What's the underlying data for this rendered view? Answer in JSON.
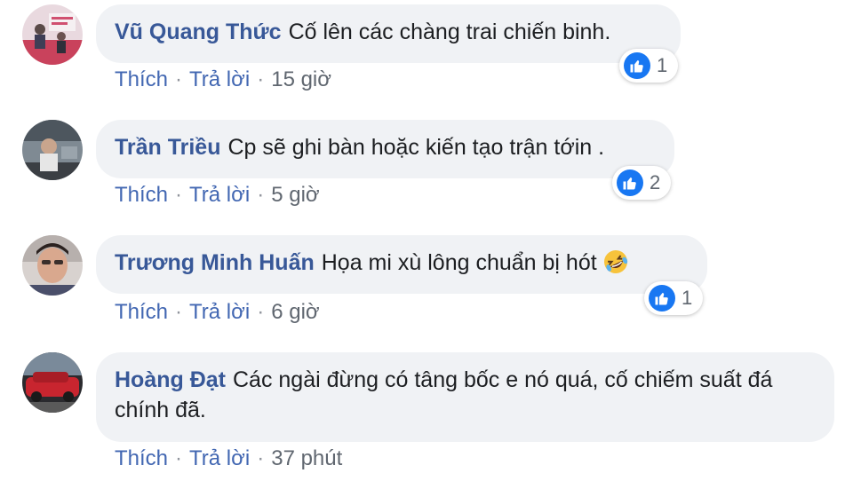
{
  "comments": [
    {
      "author": "Vũ Quang Thức",
      "text": "Cố lên các chàng trai chiến binh.",
      "actions": {
        "like": "Thích",
        "reply": "Trả lời",
        "separator": "·",
        "time": "15 giờ"
      },
      "reactions": {
        "icon": "like-icon",
        "count": "1"
      }
    },
    {
      "author": "Trần Triều",
      "text": "Cp sẽ ghi bàn hoặc kiến tạo trận tớin .",
      "actions": {
        "like": "Thích",
        "reply": "Trả lời",
        "separator": "·",
        "time": "5 giờ"
      },
      "reactions": {
        "icon": "like-icon",
        "count": "2"
      }
    },
    {
      "author": "Trương Minh Huấn",
      "text": "Họa mi xù lông chuẩn bị hót",
      "emoji": "rolling-on-floor-laughing-emoji",
      "actions": {
        "like": "Thích",
        "reply": "Trả lời",
        "separator": "·",
        "time": "6 giờ"
      },
      "reactions": {
        "icon": "like-icon",
        "count": "1"
      }
    },
    {
      "author": "Hoàng Đạt",
      "text": "Các ngài đừng có tâng bốc e nó quá, cố chiếm suất đá chính đã.",
      "actions": {
        "like": "Thích",
        "reply": "Trả lời",
        "separator": "·",
        "time": "37 phút"
      }
    }
  ],
  "colors": {
    "author": "#385898",
    "link": "#4267b2",
    "bubble": "#f0f2f5",
    "like": "#1877f2"
  }
}
